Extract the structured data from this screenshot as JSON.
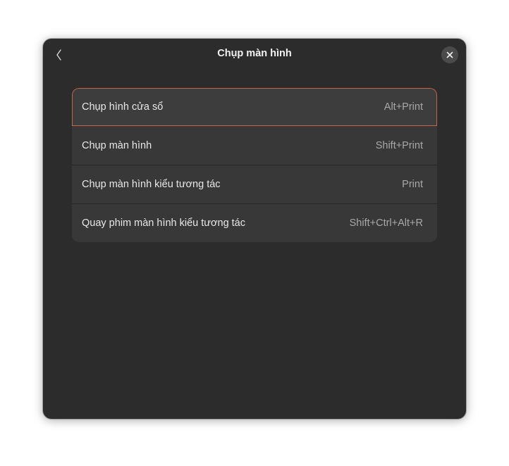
{
  "dialog": {
    "title": "Chụp màn hình",
    "back_icon": "chevron-left-icon",
    "close_icon": "close-icon"
  },
  "shortcuts": [
    {
      "label": "Chụp hình cửa sổ",
      "accel": "Alt+Print",
      "selected": true
    },
    {
      "label": "Chụp màn hình",
      "accel": "Shift+Print",
      "selected": false
    },
    {
      "label": "Chụp màn hình kiểu tương tác",
      "accel": "Print",
      "selected": false
    },
    {
      "label": "Quay phim màn hình kiểu tương tác",
      "accel": "Shift+Ctrl+Alt+R",
      "selected": false
    }
  ],
  "colors": {
    "dialog_bg": "#2c2c2c",
    "row_bg": "#383838",
    "focus_accent": "#c0664a"
  }
}
